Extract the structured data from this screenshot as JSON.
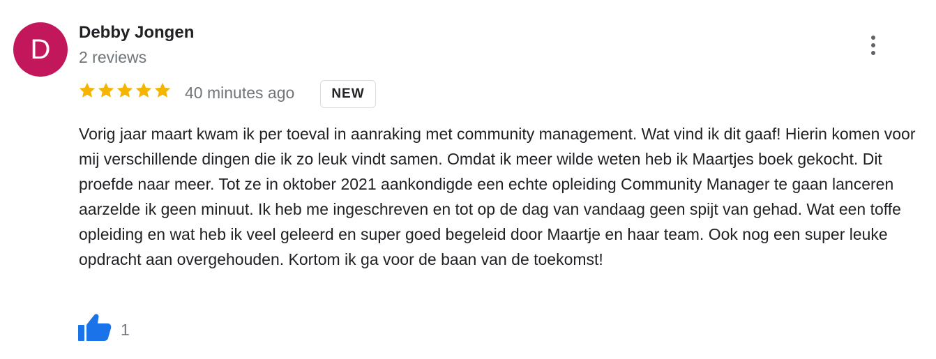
{
  "review": {
    "avatar_letter": "D",
    "avatar_color": "#c2185b",
    "author_name": "Debby Jongen",
    "review_count": "2 reviews",
    "rating": 5,
    "rating_max": 5,
    "star_color": "#f4b400",
    "time_ago": "40 minutes ago",
    "badge": "NEW",
    "text": "Vorig jaar maart kwam ik per toeval in aanraking met community management. Wat vind ik dit gaaf! Hierin komen voor mij verschillende dingen die ik zo leuk vindt samen. Omdat ik meer wilde weten heb ik Maartjes boek gekocht. Dit proefde naar meer. Tot ze in oktober 2021 aankondigde een echte opleiding Community Manager te gaan lanceren aarzelde ik geen minuut. Ik heb me ingeschreven en tot op de dag van vandaag geen spijt van gehad. Wat een toffe opleiding en wat heb ik veel geleerd en super goed begeleid door Maartje en haar team. Ook nog een super leuke opdracht aan overgehouden. Kortom ik ga voor de baan van de toekomst!",
    "like_count": "1",
    "like_color": "#1a73e8",
    "icons": {
      "more": "more-vertical-icon",
      "star": "star-icon",
      "like": "thumbs-up-icon"
    }
  }
}
